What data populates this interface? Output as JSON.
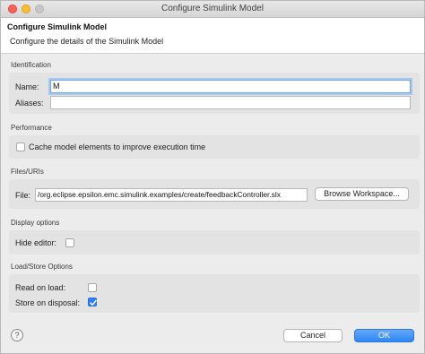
{
  "window": {
    "title": "Configure Simulink Model"
  },
  "header": {
    "title": "Configure Simulink Model",
    "description": "Configure the details of the Simulink Model"
  },
  "identification": {
    "group_label": "Identification",
    "name_label": "Name:",
    "name_value": "M",
    "aliases_label": "Aliases:",
    "aliases_value": ""
  },
  "performance": {
    "group_label": "Performance",
    "cache_label": "Cache model elements to improve execution time",
    "cache_checked": false
  },
  "files": {
    "group_label": "Files/URIs",
    "file_label": "File:",
    "file_value": "/org.eclipse.epsilon.emc.simulink.examples/create/feedbackController.slx",
    "browse_label": "Browse Workspace..."
  },
  "display": {
    "group_label": "Display options",
    "hide_editor_label": "Hide editor:",
    "hide_editor_checked": false
  },
  "loadstore": {
    "group_label": "Load/Store Options",
    "read_on_load_label": "Read on load:",
    "read_on_load_checked": false,
    "store_on_disposal_label": "Store on disposal:",
    "store_on_disposal_checked": true
  },
  "footer": {
    "help_glyph": "?",
    "cancel_label": "Cancel",
    "ok_label": "OK"
  },
  "colors": {
    "accent": "#2f87f5",
    "close": "#fe5f57",
    "minimize": "#fdbc2e"
  }
}
